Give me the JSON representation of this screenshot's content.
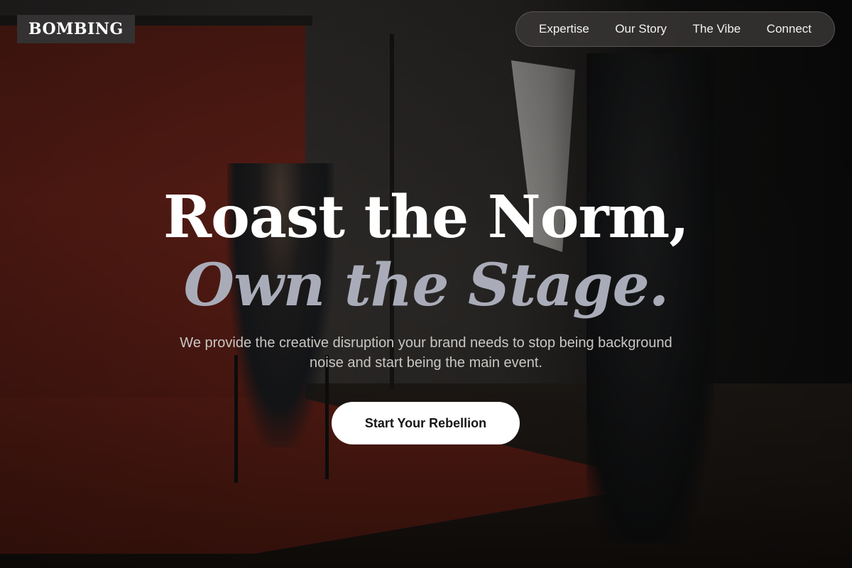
{
  "brand": {
    "logo": "BOMBING"
  },
  "nav": {
    "items": [
      {
        "label": "Expertise"
      },
      {
        "label": "Our Story"
      },
      {
        "label": "The Vibe"
      },
      {
        "label": "Connect"
      }
    ]
  },
  "hero": {
    "headline_line1": "Roast the Norm,",
    "headline_line2": "Own the Stage.",
    "subtext": "We provide the creative disruption your brand needs to stop being background noise and start being the main event.",
    "cta_label": "Start Your Rebellion"
  },
  "colors": {
    "headline_primary": "#ffffff",
    "headline_accent": "#a9acb8",
    "cta_background": "#ffffff",
    "logo_background": "#333131"
  }
}
